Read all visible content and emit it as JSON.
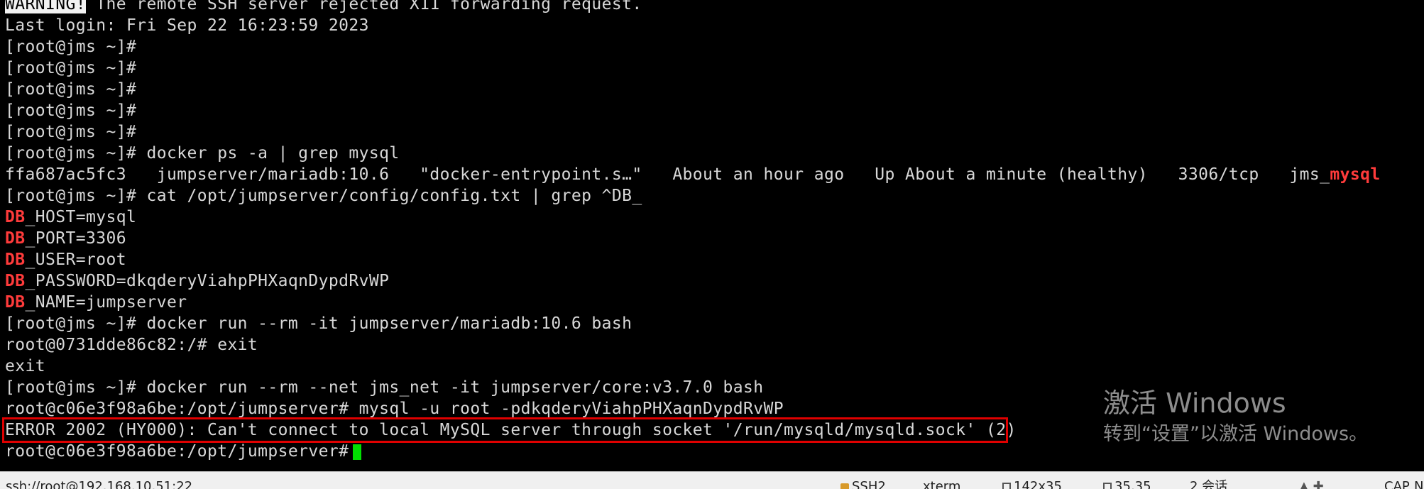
{
  "terminal": {
    "warning_badge": "WARNING!",
    "warning_text": " The remote SSH server rejected X11 forwarding request.",
    "lines": [
      "Last login: Fri Sep 22 16:23:59 2023",
      "[root@jms ~]#",
      "[root@jms ~]#",
      "[root@jms ~]#",
      "[root@jms ~]#",
      "[root@jms ~]#",
      "[root@jms ~]# docker ps -a | grep mysql"
    ],
    "docker_row": {
      "main": "ffa687ac5fc3   jumpserver/mariadb:10.6   \"docker-entrypoint.s…\"   About an hour ago   Up About a minute (healthy)   3306/tcp   jms_",
      "highlight": "mysql"
    },
    "cat_cmd": "[root@jms ~]# cat /opt/jumpserver/config/config.txt | grep ^DB_",
    "db_prefix": "DB",
    "db_vars": [
      "_HOST=mysql",
      "_PORT=3306",
      "_USER=root",
      "_PASSWORD=dkqderyViahpPHXaqnDypdRvWP",
      "_NAME=jumpserver"
    ],
    "after_lines": [
      "[root@jms ~]# docker run --rm -it jumpserver/mariadb:10.6 bash",
      "root@0731dde86c82:/# exit",
      "exit",
      "[root@jms ~]# docker run --rm --net jms_net -it jumpserver/core:v3.7.0 bash",
      "root@c06e3f98a6be:/opt/jumpserver# mysql -u root -pdkqderyViahpPHXaqnDypdRvWP"
    ],
    "error_line": "ERROR 2002 (HY000): Can't connect to local MySQL server through socket '/run/mysqld/mysqld.sock' (2)",
    "final_prompt": "root@c06e3f98a6be:/opt/jumpserver#"
  },
  "watermark": {
    "title": "激活 Windows",
    "subtitle": "转到“设置”以激活 Windows。"
  },
  "statusbar": {
    "connection": "ssh://root@192.168.10.51:22",
    "protocol": "SSH2",
    "term": "xterm",
    "size": "142x35",
    "position": "35,35",
    "sessions": "2 会话",
    "cap": "CAP",
    "num": "N"
  },
  "colors": {
    "background": "#000000",
    "text": "#d8d8d8",
    "highlight": "#ff3b3b",
    "error_box": "#e00000",
    "cursor": "#00e000"
  }
}
